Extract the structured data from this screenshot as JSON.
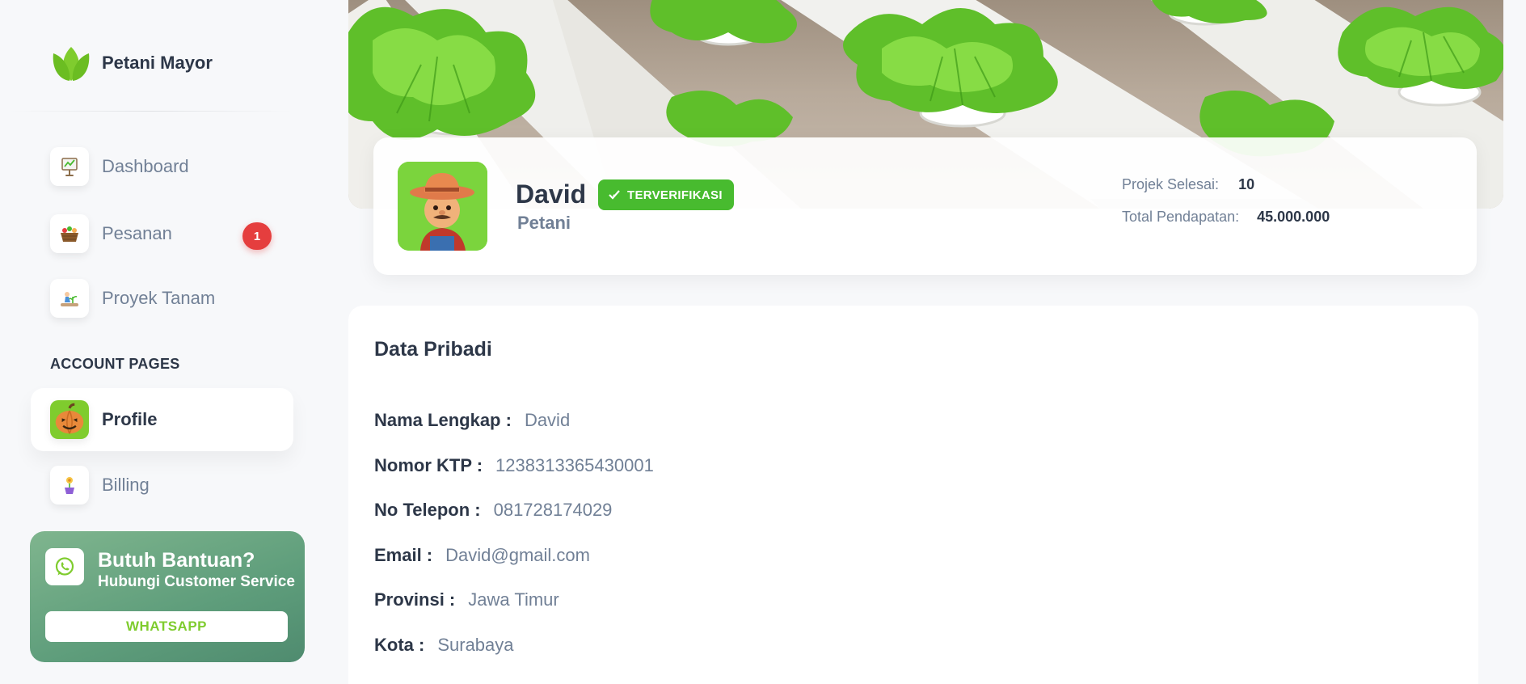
{
  "brand": {
    "name": "Petani Mayor",
    "logo": "leaf-logo"
  },
  "sidebar": {
    "items": [
      {
        "label": "Dashboard",
        "icon": "dashboard-board-icon"
      },
      {
        "label": "Pesanan",
        "icon": "basket-icon",
        "badge": "1"
      },
      {
        "label": "Proyek Tanam",
        "icon": "farmer-planting-icon"
      }
    ],
    "section_title": "ACCOUNT PAGES",
    "account_items": [
      {
        "label": "Profile",
        "icon": "pumpkin-icon",
        "active": true
      },
      {
        "label": "Billing",
        "icon": "flower-pot-icon"
      }
    ]
  },
  "help": {
    "title": "Butuh Bantuan?",
    "subtitle": "Hubungi Customer Service",
    "button": "WHATSAPP",
    "icon": "whatsapp-icon"
  },
  "profile": {
    "name": "David",
    "verified_label": "TERVERIFIKASI",
    "role": "Petani",
    "stats": [
      {
        "label": "Projek Selesai:",
        "value": "10"
      },
      {
        "label": "Total Pendapatan:",
        "value": "45.000.000"
      }
    ]
  },
  "personal": {
    "title": "Data Pribadi",
    "fields": [
      {
        "label": "Nama Lengkap :",
        "value": "David"
      },
      {
        "label": "Nomor KTP :",
        "value": "1238313365430001"
      },
      {
        "label": "No Telepon :",
        "value": "081728174029"
      },
      {
        "label": "Email :",
        "value": "David@gmail.com"
      },
      {
        "label": "Provinsi :",
        "value": "Jawa Timur"
      },
      {
        "label": "Kota :",
        "value": "Surabaya"
      }
    ]
  },
  "colors": {
    "accent": "#7fcc2e",
    "badge": "#e53e3e",
    "verified": "#48bb2f",
    "help_card": "#5e9d7b"
  }
}
